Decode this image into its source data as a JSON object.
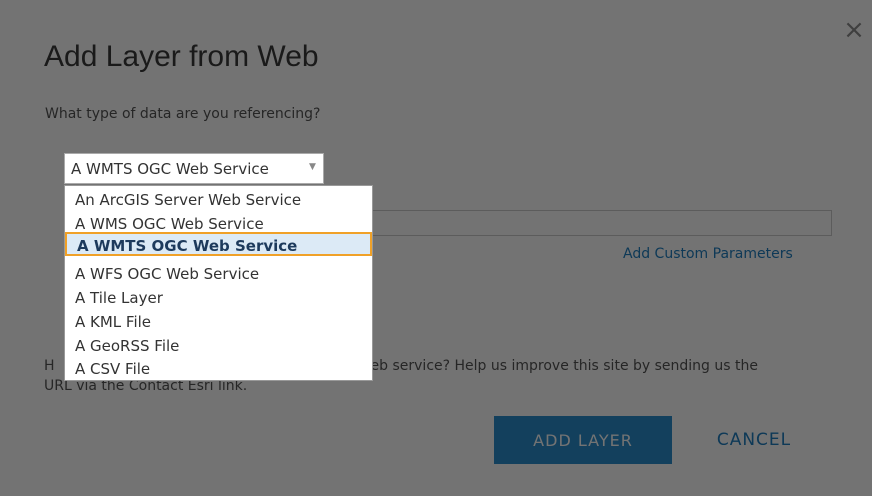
{
  "dialog": {
    "title": "Add Layer from Web",
    "close_icon": "×",
    "question": "What type of data are you referencing?",
    "selected_type": "A WMTS OGC Web Service",
    "custom_params_link": "Add Custom Parameters",
    "help_text_visible_start": "H",
    "help_text_visible_mid": "eb service? Help us improve this site by sending us the",
    "help_text_line2": "URL via the Contact Esri link.",
    "add_layer_label": "ADD LAYER",
    "cancel_label": "CANCEL"
  },
  "dropdown": {
    "options": [
      "An ArcGIS Server Web Service",
      "A WMS OGC Web Service",
      "A WMTS OGC Web Service",
      "A WFS OGC Web Service",
      "A Tile Layer",
      "A KML File",
      "A GeoRSS File",
      "A CSV File"
    ],
    "selected_index": 2
  },
  "colors": {
    "accent": "#1f7fc2",
    "button_bg": "#2a8fcf",
    "highlight_border": "#f0a128",
    "highlight_bg": "#dceaf6"
  }
}
